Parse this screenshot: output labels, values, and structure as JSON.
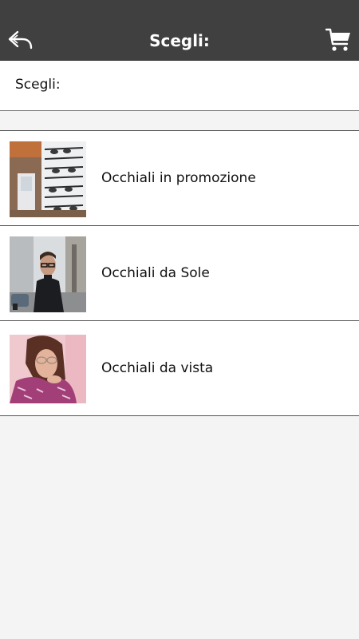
{
  "header": {
    "title": "Scegli:",
    "back_icon": "back-arrow-icon",
    "cart_icon": "shopping-cart-icon",
    "bar_color": "#404040"
  },
  "subheader": {
    "label": "Scegli:"
  },
  "categories": [
    {
      "label": "Occhiali in promozione",
      "thumbnail": "eyewear-display-photo"
    },
    {
      "label": "Occhiali da Sole",
      "thumbnail": "man-with-glasses-photo"
    },
    {
      "label": "Occhiali da vista",
      "thumbnail": "woman-with-glasses-photo"
    }
  ]
}
